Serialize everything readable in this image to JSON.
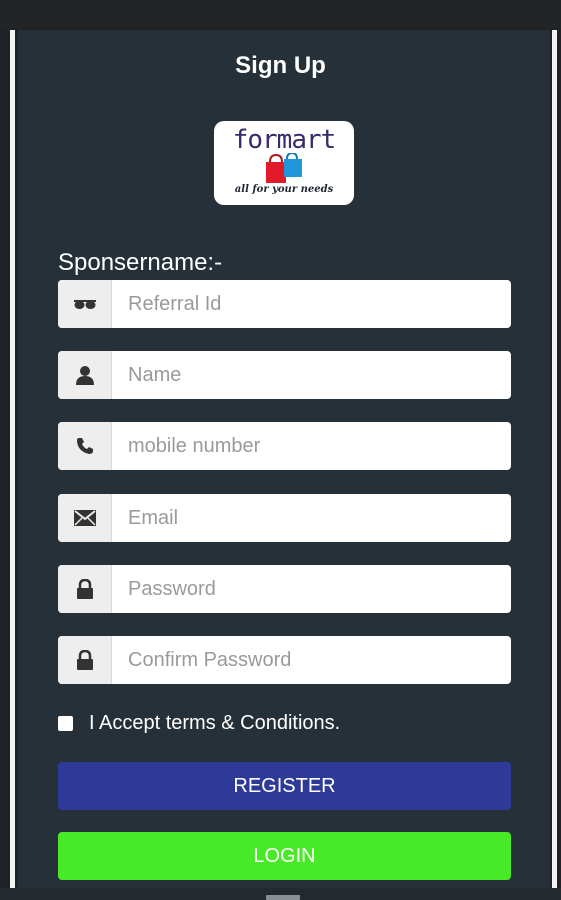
{
  "page": {
    "title": "Sign Up"
  },
  "logo": {
    "wordmark": "formart",
    "tagline": "all for your needs"
  },
  "form": {
    "section_label": "Sponsername:-",
    "fields": [
      {
        "icon": "sunglasses-icon",
        "placeholder": "Referral Id",
        "value": ""
      },
      {
        "icon": "user-icon",
        "placeholder": "Name",
        "value": ""
      },
      {
        "icon": "phone-icon",
        "placeholder": "mobile number",
        "value": ""
      },
      {
        "icon": "envelope-icon",
        "placeholder": "Email",
        "value": ""
      },
      {
        "icon": "lock-icon",
        "placeholder": "Password",
        "value": ""
      },
      {
        "icon": "lock-icon",
        "placeholder": "Confirm Password",
        "value": ""
      }
    ],
    "terms_label": "I Accept terms & Conditions.",
    "terms_checked": false,
    "register_label": "REGISTER",
    "login_label": "LOGIN"
  },
  "colors": {
    "background": "#263038",
    "register_button": "#2e3a98",
    "login_button": "#48ea27"
  }
}
